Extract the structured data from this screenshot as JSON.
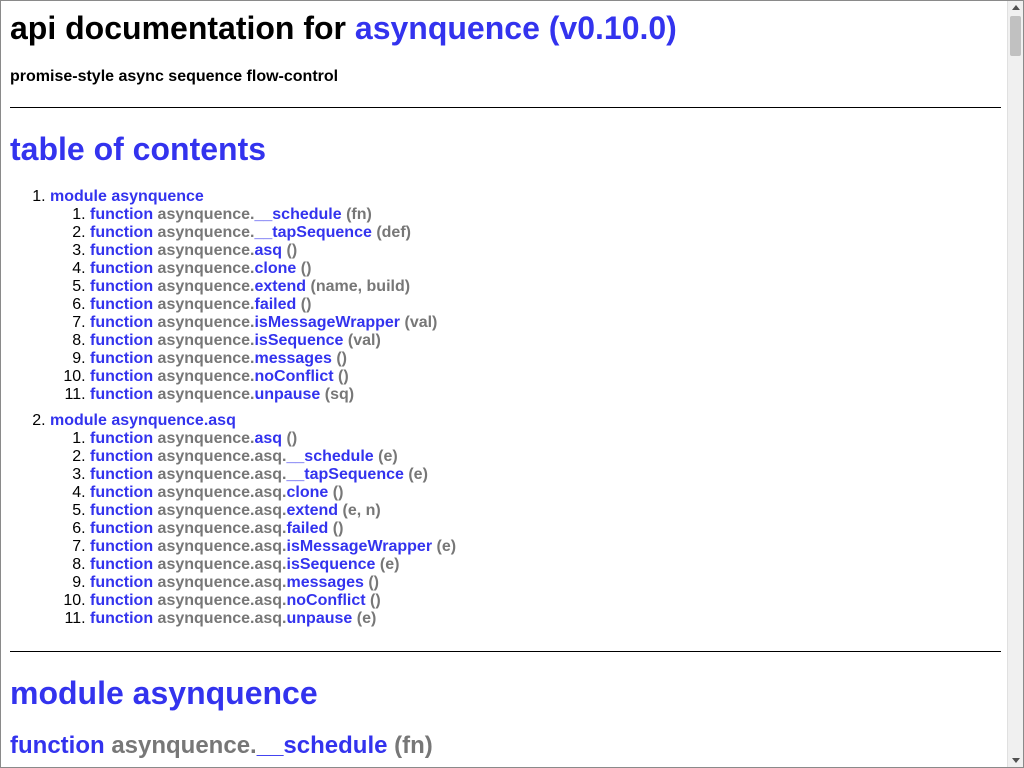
{
  "header": {
    "title_prefix": "api documentation for ",
    "title_link": "asynquence (v0.10.0)",
    "subtitle": "promise-style async sequence flow-control"
  },
  "toc": {
    "heading": "table of contents",
    "modules": [
      {
        "number": "1.",
        "keyword": "module",
        "name": "asynquence",
        "items": [
          {
            "keyword": "function",
            "prefix": "asynquence.",
            "name": "__schedule",
            "args": "(fn)"
          },
          {
            "keyword": "function",
            "prefix": "asynquence.",
            "name": "__tapSequence",
            "args": "(def)"
          },
          {
            "keyword": "function",
            "prefix": "asynquence.",
            "name": "asq",
            "args": "()"
          },
          {
            "keyword": "function",
            "prefix": "asynquence.",
            "name": "clone",
            "args": "()"
          },
          {
            "keyword": "function",
            "prefix": "asynquence.",
            "name": "extend",
            "args": "(name, build)"
          },
          {
            "keyword": "function",
            "prefix": "asynquence.",
            "name": "failed",
            "args": "()"
          },
          {
            "keyword": "function",
            "prefix": "asynquence.",
            "name": "isMessageWrapper",
            "args": "(val)"
          },
          {
            "keyword": "function",
            "prefix": "asynquence.",
            "name": "isSequence",
            "args": "(val)"
          },
          {
            "keyword": "function",
            "prefix": "asynquence.",
            "name": "messages",
            "args": "()"
          },
          {
            "keyword": "function",
            "prefix": "asynquence.",
            "name": "noConflict",
            "args": "()"
          },
          {
            "keyword": "function",
            "prefix": "asynquence.",
            "name": "unpause",
            "args": "(sq)"
          }
        ]
      },
      {
        "number": "2.",
        "keyword": "module",
        "name": "asynquence.asq",
        "items": [
          {
            "keyword": "function",
            "prefix": "asynquence.",
            "name": "asq",
            "args": "()"
          },
          {
            "keyword": "function",
            "prefix": "asynquence.asq.",
            "name": "__schedule",
            "args": "(e)"
          },
          {
            "keyword": "function",
            "prefix": "asynquence.asq.",
            "name": "__tapSequence",
            "args": "(e)"
          },
          {
            "keyword": "function",
            "prefix": "asynquence.asq.",
            "name": "clone",
            "args": "()"
          },
          {
            "keyword": "function",
            "prefix": "asynquence.asq.",
            "name": "extend",
            "args": "(e, n)"
          },
          {
            "keyword": "function",
            "prefix": "asynquence.asq.",
            "name": "failed",
            "args": "()"
          },
          {
            "keyword": "function",
            "prefix": "asynquence.asq.",
            "name": "isMessageWrapper",
            "args": "(e)"
          },
          {
            "keyword": "function",
            "prefix": "asynquence.asq.",
            "name": "isSequence",
            "args": "(e)"
          },
          {
            "keyword": "function",
            "prefix": "asynquence.asq.",
            "name": "messages",
            "args": "()"
          },
          {
            "keyword": "function",
            "prefix": "asynquence.asq.",
            "name": "noConflict",
            "args": "()"
          },
          {
            "keyword": "function",
            "prefix": "asynquence.asq.",
            "name": "unpause",
            "args": "(e)"
          }
        ]
      }
    ]
  },
  "section": {
    "heading": "module asynquence",
    "first_function": {
      "keyword": "function",
      "prefix": "asynquence.",
      "name": "__schedule",
      "args": "(fn)"
    }
  },
  "colors": {
    "link": "#3333ee",
    "muted": "#777777"
  }
}
